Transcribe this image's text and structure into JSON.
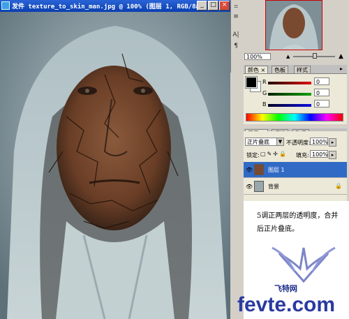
{
  "document": {
    "title": "发件 texture_to_skin_man.jpg @ 100% (图层 1, RGB/8#)",
    "minimize_glyph": "_",
    "restore_glyph": "□",
    "close_glyph": "×"
  },
  "toolbar": {
    "icons": [
      "layer-comp-icon",
      "tool-preset-icon",
      "character-icon",
      "paragraph-icon"
    ],
    "glyphs": [
      "⌗",
      "≡",
      "A|",
      "¶"
    ]
  },
  "navigator": {
    "zoom": "100%"
  },
  "color_panel": {
    "tabs": [
      "颜色",
      "色板",
      "样式"
    ],
    "channels": [
      {
        "label": "R",
        "value": "0",
        "color": "#e01010"
      },
      {
        "label": "G",
        "value": "0",
        "color": "#10a010"
      },
      {
        "label": "B",
        "value": "0",
        "color": "#1010e0"
      }
    ],
    "foreground": "#000000",
    "background": "#ffffff"
  },
  "layers_panel": {
    "tabs": [
      "图层",
      "通道",
      "路径"
    ],
    "blend_mode": "正片叠底",
    "opacity_label": "不透明度:",
    "opacity": "100%",
    "lock_label": "锁定:",
    "fill_label": "填充:",
    "fill": "100%",
    "layers": [
      {
        "name": "图层 1",
        "selected": true
      },
      {
        "name": "背景",
        "selected": false
      }
    ]
  },
  "caption": {
    "text": "5调正两层的透明度，合并后正片叠底。"
  },
  "watermark": {
    "brand": "飞特网",
    "url": "fevte.com"
  }
}
